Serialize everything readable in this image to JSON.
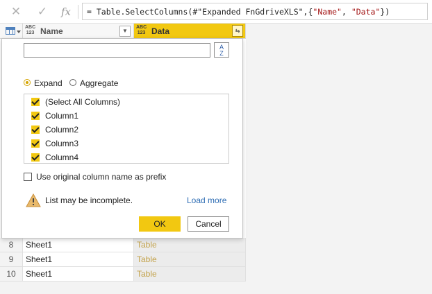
{
  "formula_bar": {
    "cancel_icon": "close-icon",
    "commit_icon": "check-icon",
    "fx_label": "fx",
    "formula_prefix": "= Table.SelectColumns(#\"Expanded FnGdriveXLS\",{",
    "formula_arg1": "\"Name\"",
    "formula_sep": ", ",
    "formula_arg2": "\"Data\"",
    "formula_suffix": "})"
  },
  "grid": {
    "columns": [
      {
        "type_label_top": "ABC",
        "type_label_bottom": "123",
        "title": "Name"
      },
      {
        "type_label_top": "ABC",
        "type_label_bottom": "123",
        "title": "Data"
      }
    ],
    "rows": [
      {
        "index": "8",
        "name": "Sheet1",
        "data": "Table"
      },
      {
        "index": "9",
        "name": "Sheet1",
        "data": "Table"
      },
      {
        "index": "10",
        "name": "Sheet1",
        "data": "Table"
      }
    ]
  },
  "expand_popup": {
    "search_value": "",
    "sort_icon": "sort-az-icon",
    "sort_label_top": "A",
    "sort_label_bottom": "Z",
    "mode_expand": "Expand",
    "mode_aggregate": "Aggregate",
    "selected_mode": "Expand",
    "columns_list": [
      {
        "label": "(Select All Columns)",
        "checked": true
      },
      {
        "label": "Column1",
        "checked": true
      },
      {
        "label": "Column2",
        "checked": true
      },
      {
        "label": "Column3",
        "checked": true
      },
      {
        "label": "Column4",
        "checked": true
      }
    ],
    "prefix_label": "Use original column name as prefix",
    "prefix_checked": false,
    "warning_icon": "warning-icon",
    "warning_text": "List may be incomplete.",
    "load_more": "Load more",
    "ok_label": "OK",
    "cancel_label": "Cancel"
  },
  "colors": {
    "accent": "#f2c811",
    "link": "#2e6db4",
    "table_value": "#c3a24a"
  }
}
